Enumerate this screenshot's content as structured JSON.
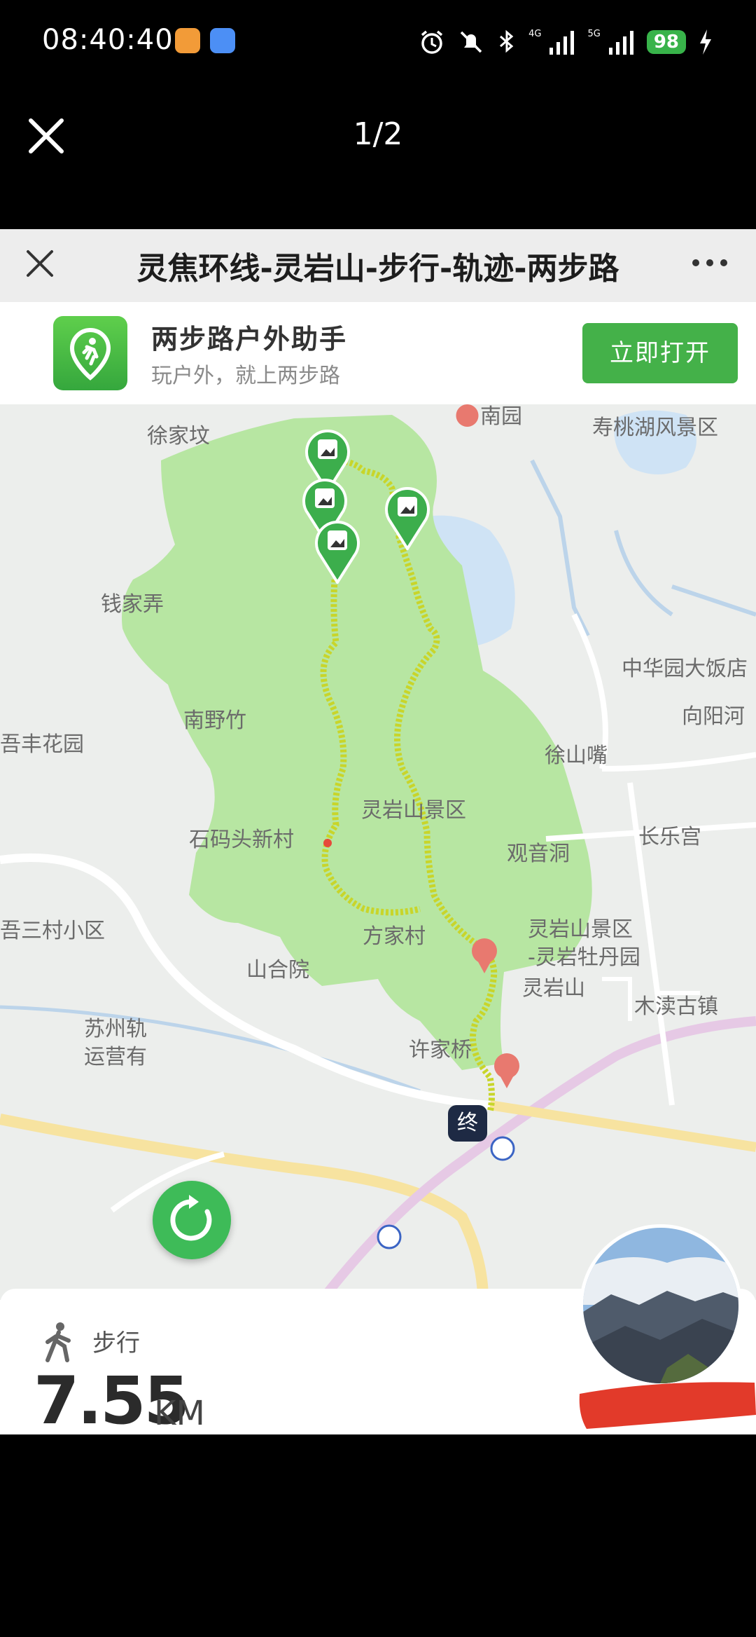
{
  "status_bar": {
    "time": "08:40:40",
    "network_1": "4G",
    "network_2": "5G",
    "battery": "98"
  },
  "viewer": {
    "counter": "1/2"
  },
  "page": {
    "title": "灵焦环线-灵岩山-步行-轨迹-两步路"
  },
  "banner": {
    "app_name": "两步路户外助手",
    "slogan": "玩户外，就上两步路",
    "open_button": "立即打开"
  },
  "map": {
    "labels": {
      "nanyuan": "南园",
      "xujiafen": "徐家坟",
      "shoutaohu": "寿桃湖风景区",
      "qianjianong": "钱家弄",
      "zhonghuayuan": "中华园大饭店",
      "nanyezhu": "南野竹",
      "xiangyanghe": "向阳河",
      "fenghuayuan": "吾丰花园",
      "xushanzui": "徐山嘴",
      "lingyanshan_area": "灵岩山景区",
      "shimatou": "石码头新村",
      "guanyindong": "观音洞",
      "changlegong": "长乐宫",
      "sancun": "吾三村小区",
      "fangjiacun": "方家村",
      "end_marker": "终",
      "lingyan_peony_1": "灵岩山景区",
      "lingyan_peony_2": "-灵岩牡丹园",
      "shanheyuan": "山合院",
      "lingyanshan_station": "灵岩山",
      "mudugu": "木渎古镇",
      "suzhou_1": "苏州轨",
      "suzhou_2": "运营有",
      "xujiaqiao": "许家桥"
    },
    "colors": {
      "park": "#b7e6a2",
      "water": "#cfe3f5",
      "track": "#c8d52a",
      "marker": "#3cae4c"
    }
  },
  "stats": {
    "mode": "步行",
    "distance": "7.55",
    "unit": "KM"
  }
}
